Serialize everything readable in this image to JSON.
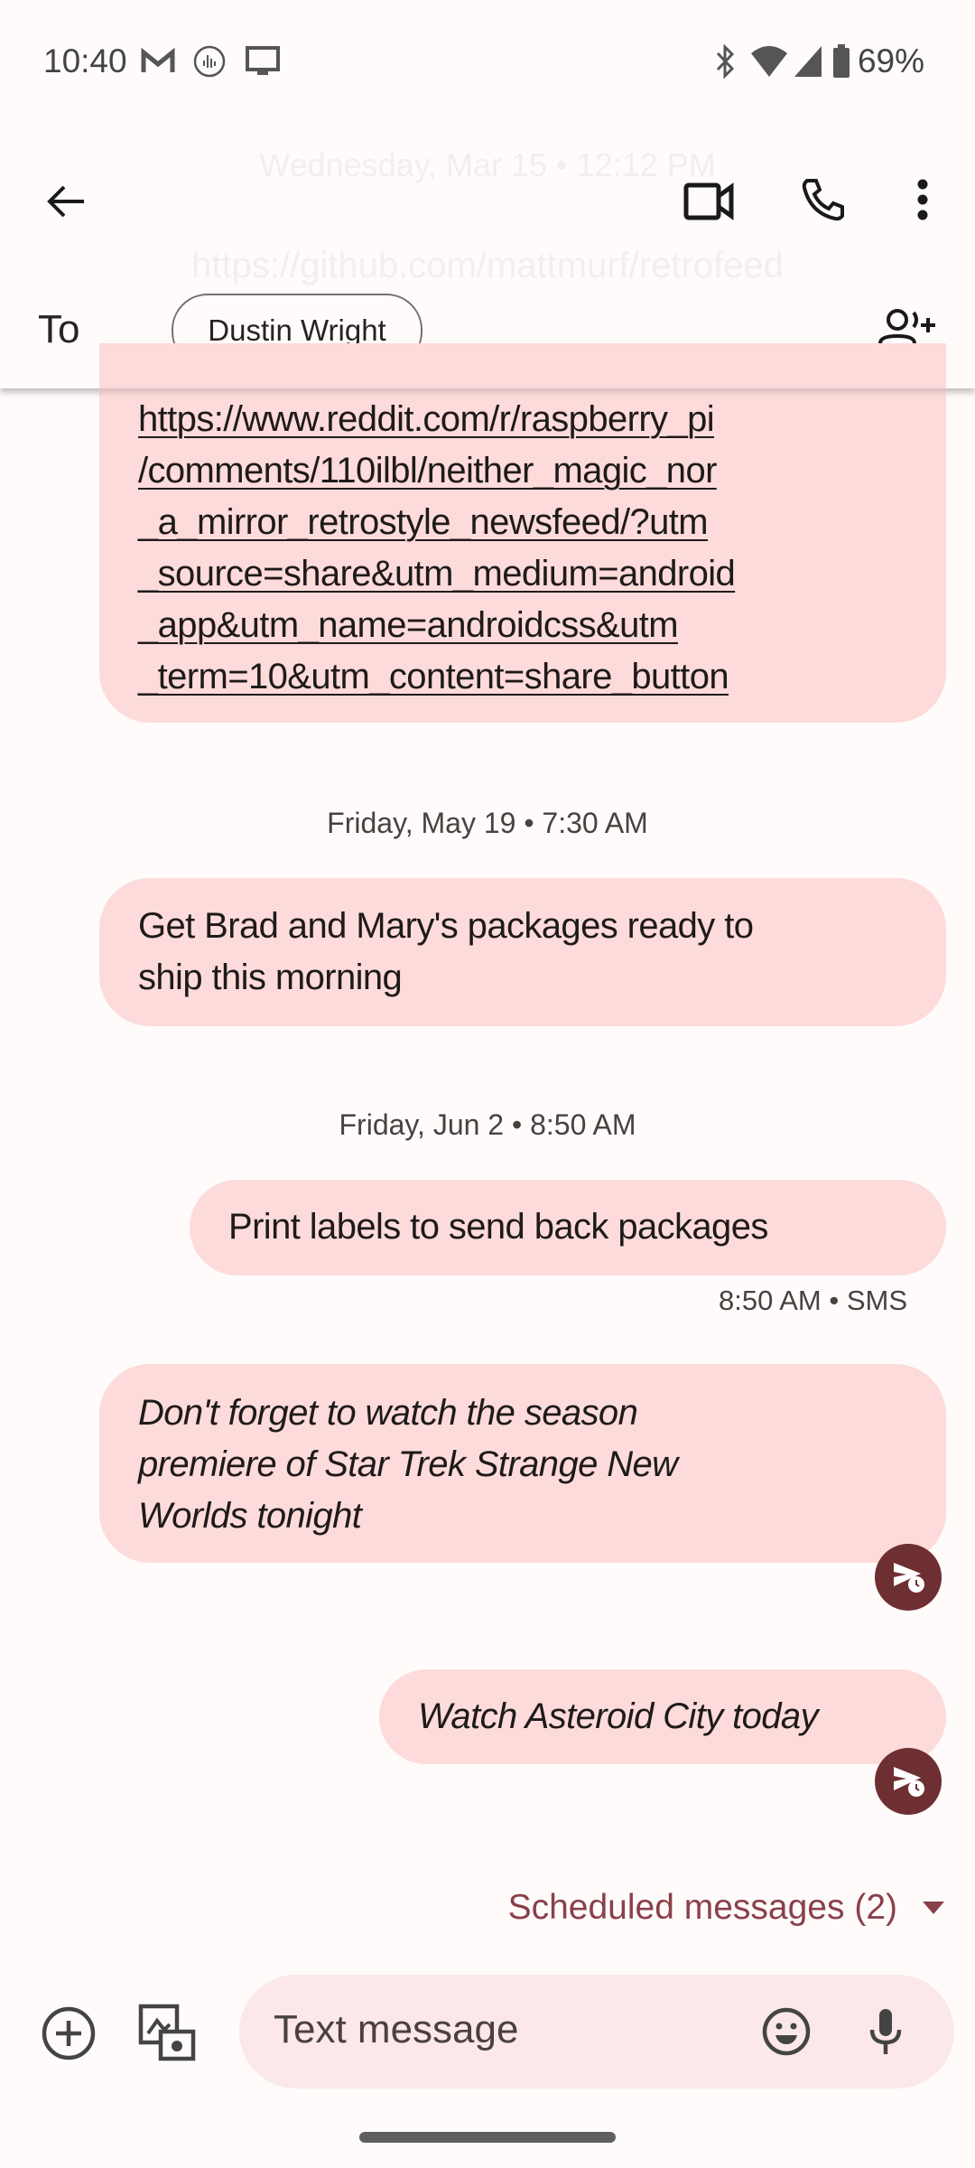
{
  "status_bar": {
    "time": "10:40",
    "battery": "69%",
    "left_icons": [
      "gmail-icon",
      "podcast-icon",
      "cast-icon"
    ],
    "right_icons": [
      "bluetooth-icon",
      "wifi-icon",
      "signal-icon",
      "battery-icon"
    ]
  },
  "background_ghost": {
    "date": "Wednesday, Mar 15 • 12:12 PM",
    "url": "https://github.com/mattmurf/retrofeed"
  },
  "header": {
    "to_label": "To",
    "recipient": "Dustin Wright"
  },
  "messages": [
    {
      "type": "incoming",
      "link": true,
      "lines": [
        "https://www.reddit.com/r/raspberry_pi",
        "/comments/110ilbl/neither_magic_nor",
        "_a_mirror_retrostyle_newsfeed/?utm",
        "_source=share&utm_medium=android",
        "_app&utm_name=androidcss&utm",
        "_term=10&utm_content=share_button"
      ]
    },
    {
      "type": "date",
      "text": "Friday, May 19 • 7:30 AM"
    },
    {
      "type": "incoming",
      "lines": [
        "Get Brad and Mary's packages ready to",
        "ship this morning"
      ]
    },
    {
      "type": "date",
      "text": "Friday, Jun 2 • 8:50 AM"
    },
    {
      "type": "outgoing",
      "lines": [
        "Print labels to send back packages"
      ],
      "meta": "8:50 AM • SMS"
    },
    {
      "type": "scheduled",
      "lines": [
        "Don't forget to watch the season",
        "premiere of Star Trek Strange New",
        "Worlds tonight"
      ]
    },
    {
      "type": "scheduled",
      "lines": [
        "Watch Asteroid City today"
      ]
    }
  ],
  "scheduled_toggle": "Scheduled messages (2)",
  "composer": {
    "placeholder": "Text message"
  },
  "colors": {
    "bubble": "#fddbdb",
    "accent": "#8a4049",
    "scheduled_badge": "#6e2f33",
    "background": "#fffbfb"
  }
}
